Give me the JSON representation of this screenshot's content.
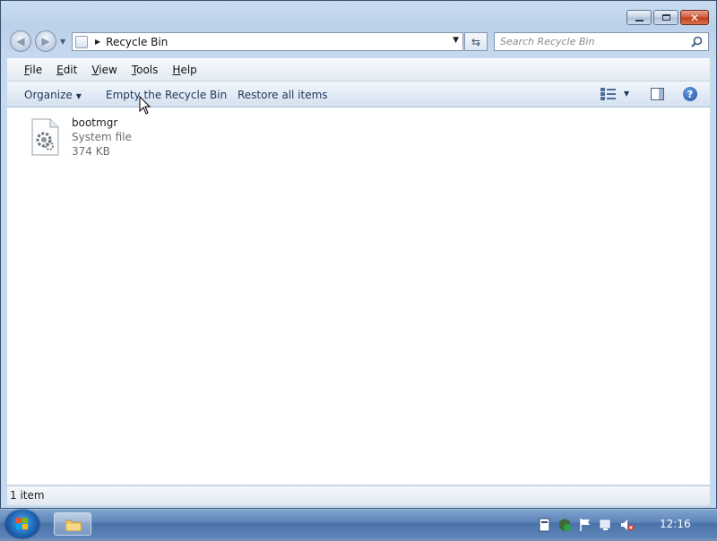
{
  "window": {
    "caption": {
      "minimize": "minimize",
      "maximize": "maximize",
      "close": "✕"
    }
  },
  "nav": {
    "back_icon": "back-arrow-icon",
    "forward_icon": "forward-arrow-icon",
    "breadcrumb": "Recycle Bin",
    "search_placeholder": "Search Recycle Bin"
  },
  "menu": {
    "items": [
      {
        "first": "F",
        "rest": "ile"
      },
      {
        "first": "E",
        "rest": "dit"
      },
      {
        "first": "V",
        "rest": "iew"
      },
      {
        "first": "T",
        "rest": "ools"
      },
      {
        "first": "H",
        "rest": "elp"
      }
    ]
  },
  "toolbar": {
    "organize": "Organize",
    "empty": "Empty the Recycle Bin",
    "restore": "Restore all items",
    "help": "?"
  },
  "files": [
    {
      "name": "bootmgr",
      "type": "System file",
      "size": "374 KB"
    }
  ],
  "status": {
    "text": "1 item"
  },
  "taskbar": {
    "clock": "12:16"
  },
  "colors": {
    "accent": "#1e395b",
    "window_frame": "#c9dbef",
    "taskbar": "#5c84b8"
  }
}
